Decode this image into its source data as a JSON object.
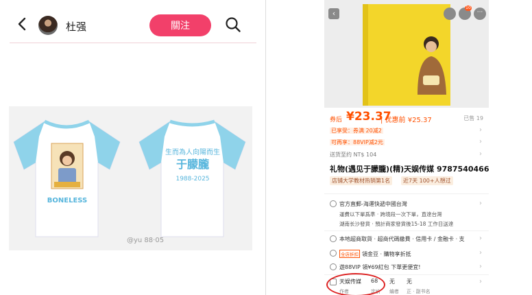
{
  "left": {
    "user_name": "杜强",
    "follow_label": "關注",
    "shirt_front_text": "BONELESS",
    "shirt_back_line1": "生而為人向陽而生",
    "shirt_back_line2": "于朦朧",
    "shirt_back_line3": "1988-2025",
    "watermark": "@yu 88·05",
    "colors": {
      "follow": "#f2406a",
      "sleeve": "#8fd3ea"
    }
  },
  "right": {
    "nav": {
      "cart_badge": "10"
    },
    "price": {
      "coupon_label": "券后",
      "after_coupon": "¥23.37",
      "discount_label": "优惠前",
      "before_coupon": "¥25.37",
      "sold": "已售 19"
    },
    "promos": [
      {
        "text": "已享受：券满 20减2"
      },
      {
        "text": "可再享：88VIP减2元"
      },
      {
        "text": "送货至约 NT$ 104"
      }
    ],
    "title": "礼物(遇见于朦朧)(精)天娱传媒 9787540466008",
    "tags": [
      "店铺大学教材热销第1名",
      "近7天 100+人想过"
    ],
    "service": {
      "line1": "官方直郵-海運快遞中國台灣",
      "line2": "運費以下單爲準 · 跨境段一次下單，直達台灣",
      "line3": "湖南长沙發貨 · 預計商家發貨後15-18 工作日送達"
    },
    "pickup": {
      "text": "本地超商取貨 · 超商代碼繳費 · 信用卡 / 金融卡 · 支"
    },
    "gold": {
      "tag": "全店折扣",
      "text": "領金豆 · 購物享折抵"
    },
    "vip": {
      "text": "遊88VIP 領¥69紅包 下單更便宜!"
    },
    "specs": [
      {
        "value": "天娱传媒",
        "label": "作者"
      },
      {
        "value": "68",
        "label": "定价"
      },
      {
        "value": "无",
        "label": "编者"
      },
      {
        "value": "无",
        "label": "正 · 副书名"
      }
    ],
    "colors": {
      "accent": "#ff5000",
      "book": "#f3d62a"
    }
  }
}
